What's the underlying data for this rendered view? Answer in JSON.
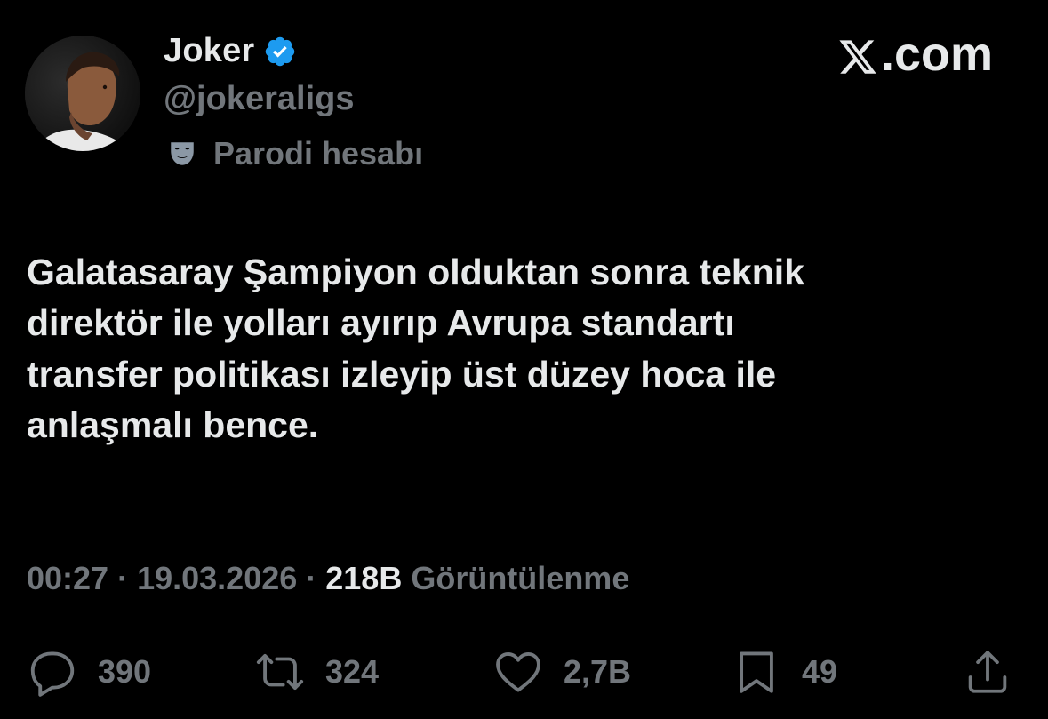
{
  "author": {
    "display_name": "Joker",
    "handle": "@jokeraligs",
    "verified": true,
    "parody_label": "Parodi hesabı"
  },
  "brand": {
    "domain": ".com"
  },
  "tweet": {
    "text": "Galatasaray Şampiyon olduktan sonra teknik\ndirektör ile yolları ayırıp Avrupa standartı\ntransfer politikası izleyip üst düzey hoca ile\nanlaşmalı bence."
  },
  "meta": {
    "time": "00:27",
    "separator": "·",
    "date": "19.03.2026",
    "views_count": "218B",
    "views_label": "Görüntülenme"
  },
  "actions": {
    "replies": "390",
    "reposts": "324",
    "likes": "2,7B",
    "bookmarks": "49"
  },
  "colors": {
    "background": "#000000",
    "primary_text": "#e7e9ea",
    "secondary_text": "#71767b",
    "verified_badge": "#1d9bf0"
  },
  "icons": {
    "verified": "verified-badge-icon",
    "parody": "mask-icon",
    "brand": "x-logo-icon",
    "reply": "reply-icon",
    "repost": "repost-icon",
    "like": "heart-icon",
    "bookmark": "bookmark-icon",
    "share": "share-icon"
  }
}
